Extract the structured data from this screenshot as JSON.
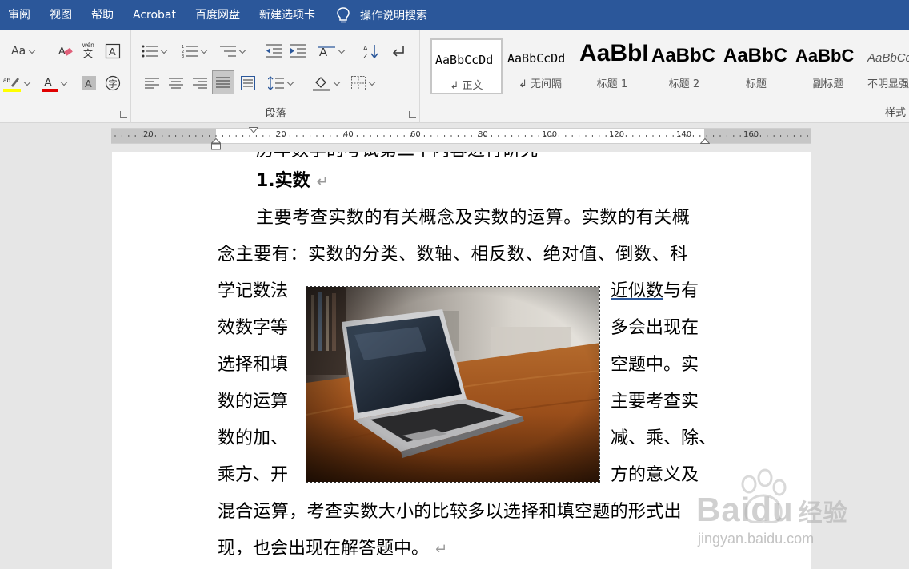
{
  "menu": {
    "items": [
      "审阅",
      "视图",
      "帮助",
      "Acrobat",
      "百度网盘",
      "新建选项卡"
    ],
    "tell_me": "操作说明搜索"
  },
  "ribbon": {
    "font_size_label": "Aa",
    "paragraph_group_label": "段落",
    "styles_group_label": "样式",
    "styles": [
      {
        "preview": "AaBbCcDd",
        "name": "↲ 正文"
      },
      {
        "preview": "AaBbCcDd",
        "name": "↲ 无间隔"
      },
      {
        "preview": "AaBbI",
        "name": "标题 1"
      },
      {
        "preview": "AaBbC",
        "name": "标题 2"
      },
      {
        "preview": "AaBbC",
        "name": "标题"
      },
      {
        "preview": "AaBbC",
        "name": "副标题"
      },
      {
        "preview": "AaBbCc",
        "name": "不明显强调"
      }
    ]
  },
  "ruler": {
    "labels": [
      "20",
      "20",
      "40",
      "60",
      "80",
      "100",
      "120",
      "140",
      "160"
    ]
  },
  "document": {
    "top_partial": "历年数学的考试第二个内容进行研究",
    "heading": "1.实数",
    "lines_full": [
      "主要考查实数的有关概念及实数的运算。实数的有关概",
      "念主要有：实数的分类、数轴、相反数、绝对值、倒数、科"
    ],
    "left_column": [
      "学记数法",
      "效数字等",
      "选择和填",
      "数的运算",
      "数的加、",
      "乘方、开"
    ],
    "right_column_first_link": "近似数",
    "right_column_first_rest": "与有",
    "right_column": [
      "多会出现在",
      "空题中。实",
      "主要考查实",
      "减、乘、除、",
      "方的意义及"
    ],
    "after_lines": [
      "混合运算，考查实数大小的比较多以选择和填空题的形式出",
      "现，也会出现在解答题中。"
    ],
    "para_mark": "↵"
  },
  "watermark": {
    "brand": "Baidu",
    "brand_cn": "经验",
    "url": "jingyan.baidu.com"
  },
  "colors": {
    "menubar": "#2b579a",
    "ribbon": "#f3f3f3",
    "highlight_yellow": "#ffff00",
    "font_red": "#e00000"
  }
}
